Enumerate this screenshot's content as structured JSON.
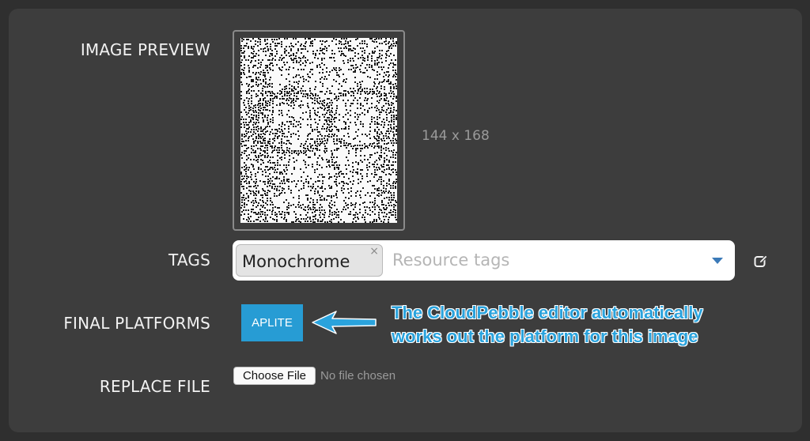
{
  "form": {
    "image_preview_label": "IMAGE PREVIEW",
    "image_dimensions": "144 x 168",
    "tags_label": "TAGS",
    "tags": [
      {
        "label": "Monochrome",
        "remove_glyph": "×"
      }
    ],
    "tags_placeholder": "Resource tags",
    "final_platforms_label": "FINAL PLATFORMS",
    "platforms": [
      "APLITE"
    ],
    "replace_file_label": "REPLACE FILE",
    "choose_file_label": "Choose File",
    "file_status": "No file chosen"
  },
  "annotation": {
    "lines": [
      "The CloudPebble editor automatically",
      "works out the platform for this image"
    ]
  },
  "icons": {
    "tag_remove": "close-icon",
    "tags_dropdown": "chevron-down-icon",
    "edit_tags": "edit-icon",
    "callout": "arrow-left-icon"
  },
  "colors": {
    "page_background": "#2f2f2f",
    "panel_background": "#3d3d3d",
    "accent": "#279cd4",
    "label_text": "#f2f2f2",
    "muted_text": "#9a9a9a"
  }
}
